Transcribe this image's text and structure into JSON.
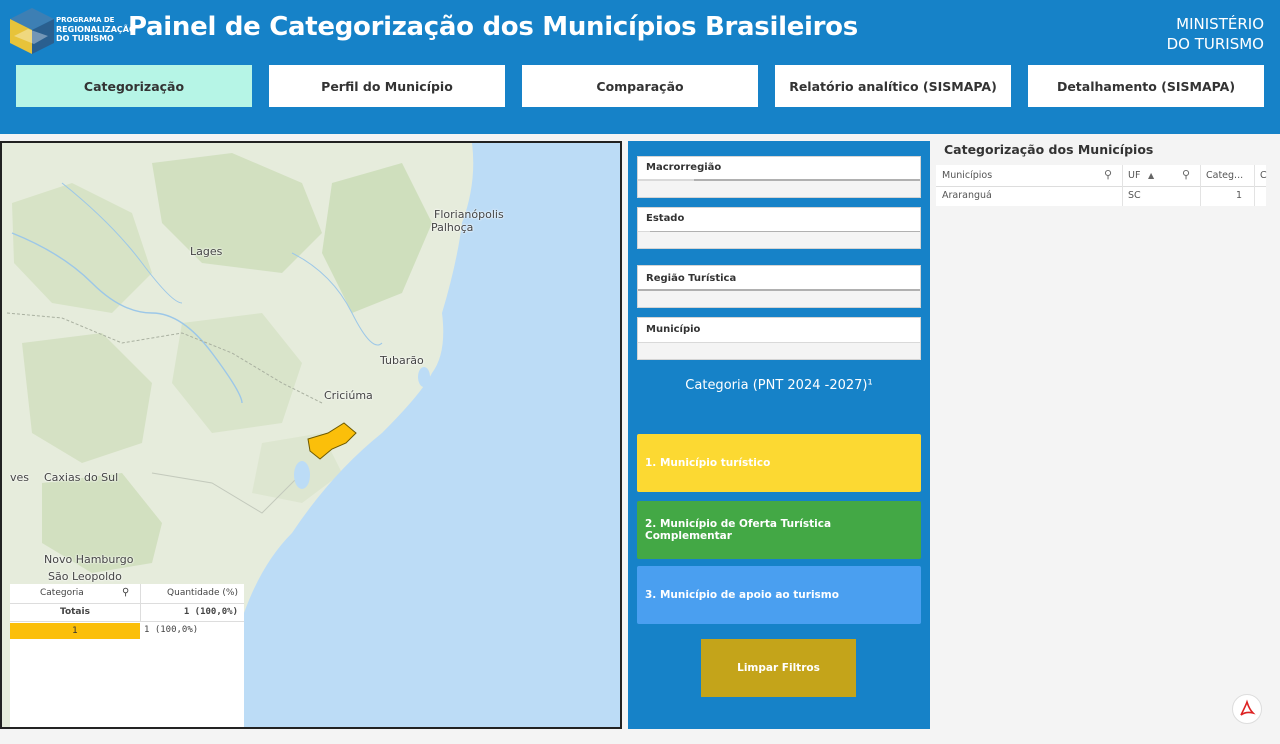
{
  "header": {
    "logo_lines": [
      "PROGRAMA DE",
      "REGIONALIZAÇÃO",
      "DO TURISMO"
    ],
    "title": "Painel de Categorização dos Municípios Brasileiros",
    "ministry_line1": "MINISTÉRIO",
    "ministry_line2": "DO TURISMO"
  },
  "tabs": [
    {
      "label": "Categorização",
      "active": true
    },
    {
      "label": "Perfil do Município",
      "active": false
    },
    {
      "label": "Comparação",
      "active": false
    },
    {
      "label": "Relatório analítico (SISMAPA)",
      "active": false
    },
    {
      "label": "Detalhamento (SISMAPA)",
      "active": false
    }
  ],
  "map": {
    "labels": [
      "Florianópolis",
      "Palhoça",
      "Lages",
      "Tubarão",
      "Criciúma",
      "ves",
      "Caxias do Sul",
      "Novo Hamburgo",
      "São Leopoldo"
    ],
    "highlight_color": "#fbbf0a"
  },
  "category_table": {
    "col_category": "Categoria",
    "col_quantity": "Quantidade (%)",
    "totals_label": "Totais",
    "totals_value": "1 (100,0%)",
    "row_category": "1",
    "row_value": "1 (100,0%)"
  },
  "filters": {
    "macrorregiao": "Macrorregião",
    "estado": "Estado",
    "regiao_turistica": "Região Turística",
    "municipio": "Município"
  },
  "categories": {
    "title": "Categoria (PNT 2024 -2027)¹",
    "cat1": "1. Município turístico",
    "cat2": "2. Município de Oferta Turística Complementar",
    "cat3": "3. Município de apoio ao turismo",
    "colors": [
      "#fcd932",
      "#43a845",
      "#4a9ff0"
    ]
  },
  "clear_button": "Limpar Filtros",
  "municipios_table": {
    "title": "Categorização dos Municípios",
    "col_municipios": "Municípios",
    "col_uf": "UF",
    "col_categoria": "Categ...",
    "col_extra": "C",
    "rows": [
      {
        "municipio": "Araranguá",
        "uf": "SC",
        "categoria": "1"
      }
    ]
  }
}
